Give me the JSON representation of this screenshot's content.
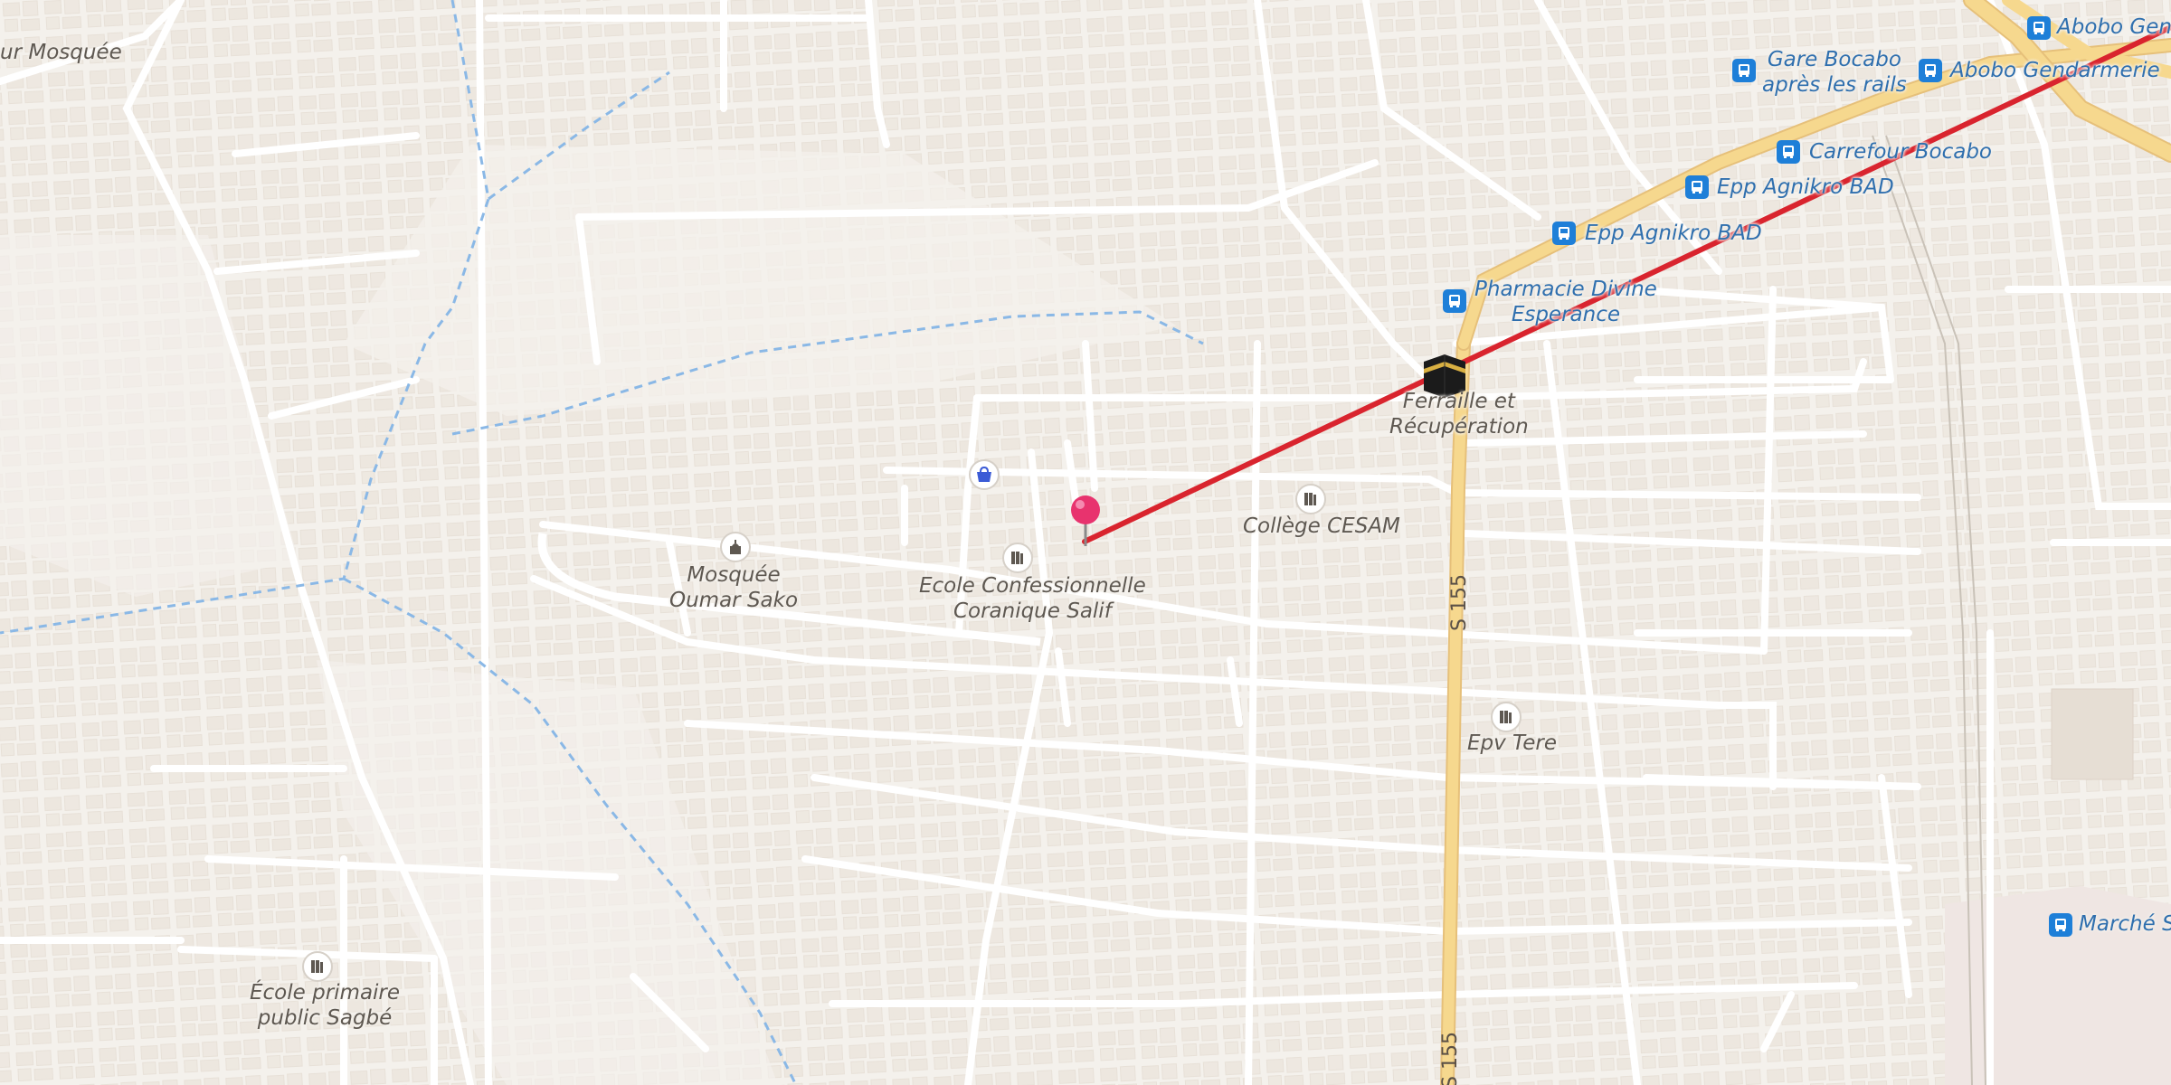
{
  "map": {
    "labels": {
      "mosquee_partial": "ur Mosquée",
      "mosquee_oumar_1": "Mosquée",
      "mosquee_oumar_2": "Oumar Sako",
      "ecole_conf_1": "Ecole Confessionnelle",
      "ecole_conf_2": "Coranique Salif",
      "college_cesam": "Collège CESAM",
      "ferraille_1": "Ferraille et",
      "ferraille_2": "Récupération",
      "epv_tere": "Epv Tere",
      "ecole_sagbe_1": "École primaire",
      "ecole_sagbe_2": "public Sagbé",
      "pharmacie_1": "Pharmacie Divine",
      "pharmacie_2": "Esperance",
      "epp_agnikro_1": "Epp Agnikro BAD",
      "epp_agnikro_2": "Epp Agnikro BAD",
      "carrefour_bocabo": "Carrefour Bocabo",
      "gare_bocabo_1": "Gare Bocabo",
      "gare_bocabo_2": "après les rails",
      "abobo_gendarmerie": "Abobo Gendarmerie",
      "abobo_gend_partial": "Abobo Gend",
      "marche_partial": "Marché S",
      "road_s155_a": "S 155",
      "road_s155_b": "S 155"
    },
    "colors": {
      "background": "#f4f1ec",
      "building": "#e6ddd3",
      "road": "#ffffff",
      "main_road": "#f6d88e",
      "stream": "#8ab8e6",
      "route_line": "#d9242e",
      "pin": "#e8336e",
      "bus_icon": "#1e7fd8"
    },
    "icons": [
      "shopping-bag-icon",
      "mosque-icon",
      "school-icon",
      "kaaba-icon",
      "bus-stop-icon",
      "map-pin-icon"
    ]
  }
}
